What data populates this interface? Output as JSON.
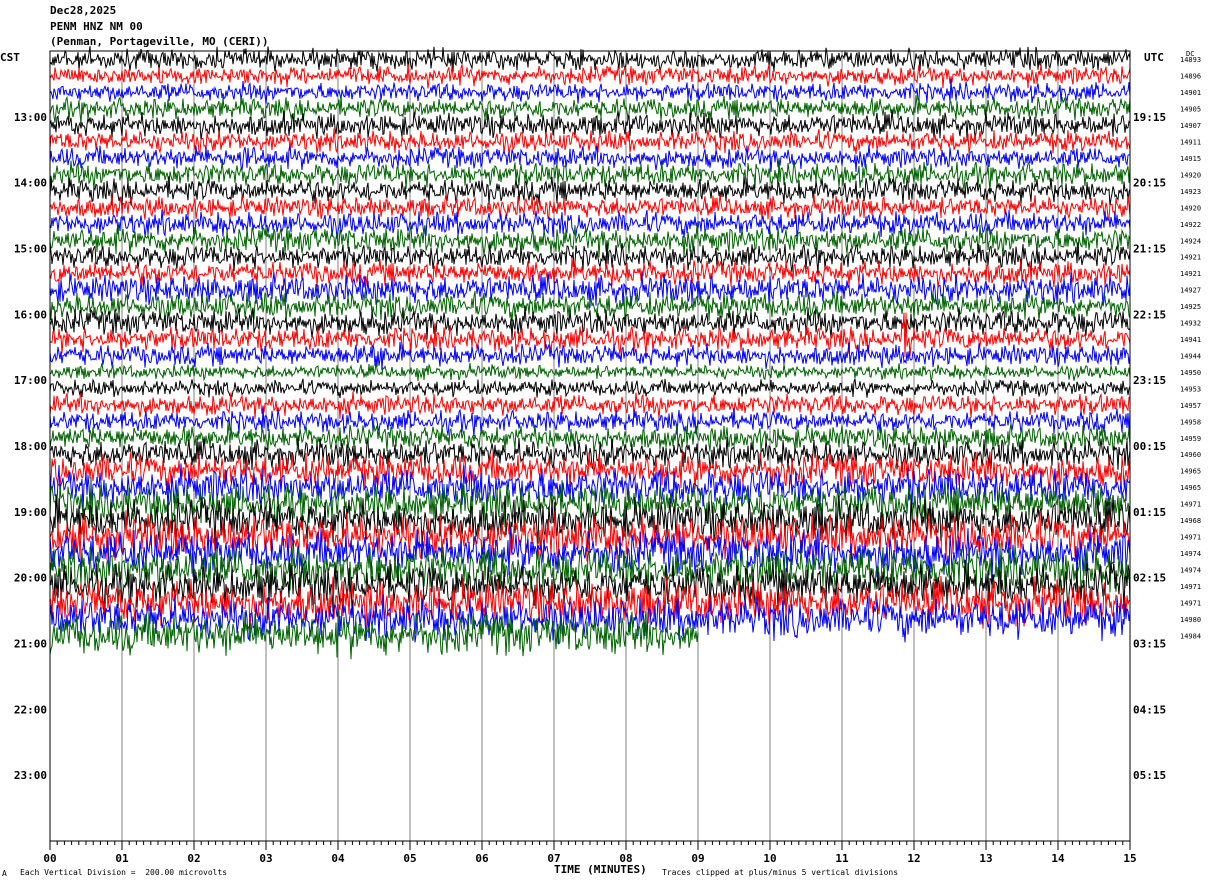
{
  "header": {
    "date": "Dec28,2025",
    "station": "PENM HNZ NM 00",
    "location": "(Penman, Portageville, MO (CERI))"
  },
  "left_timezone": "CST",
  "right_timezone": "UTC",
  "dc_label": "DC",
  "footer": {
    "left_mark": "A",
    "scale_note": "Each Vertical Division =  200.00 microvolts",
    "clip_note": "Traces clipped at plus/minus 5 vertical divisions"
  },
  "colors": {
    "trace_cycle": [
      "#000000",
      "#ff0000",
      "#0000ff",
      "#006400"
    ],
    "grid": "#808080",
    "frame": "#000000"
  },
  "chart_data": {
    "type": "line",
    "title": "PENM HNZ NM 00",
    "xlabel": "TIME (MINUTES)",
    "ylabel": "",
    "xlim": [
      0,
      15
    ],
    "x_ticks": [
      "00",
      "01",
      "02",
      "03",
      "04",
      "05",
      "06",
      "07",
      "08",
      "09",
      "10",
      "11",
      "12",
      "13",
      "14",
      "15"
    ],
    "left_hour_labels": [
      "13:00",
      "14:00",
      "15:00",
      "16:00",
      "17:00",
      "18:00",
      "19:00",
      "20:00",
      "21:00",
      "22:00",
      "23:00"
    ],
    "right_hour_labels": [
      "19:15",
      "20:15",
      "21:15",
      "22:15",
      "23:15",
      "00:15",
      "01:15",
      "02:15",
      "03:15",
      "04:15",
      "05:15"
    ],
    "rows_per_hour": 4,
    "total_rows": 48,
    "trace_count": 36,
    "last_trace_end_minute": 9,
    "dc_offsets": [
      14893,
      14896,
      14901,
      14905,
      14907,
      14911,
      14915,
      14920,
      14923,
      14920,
      14922,
      14924,
      14921,
      14921,
      14927,
      14925,
      14932,
      14941,
      14944,
      14950,
      14953,
      14957,
      14958,
      14959,
      14960,
      14965,
      14965,
      14971,
      14968,
      14971,
      14974,
      14974,
      14971,
      14971,
      14980,
      14984
    ],
    "trace_amplitude_rel": [
      0.45,
      0.4,
      0.4,
      0.45,
      0.5,
      0.45,
      0.45,
      0.5,
      0.5,
      0.45,
      0.5,
      0.55,
      0.5,
      0.5,
      0.6,
      0.55,
      0.55,
      0.5,
      0.45,
      0.3,
      0.35,
      0.45,
      0.45,
      0.5,
      0.6,
      0.7,
      0.8,
      0.8,
      0.85,
      0.9,
      0.9,
      0.95,
      0.9,
      0.9,
      0.85,
      0.9
    ],
    "events": [
      {
        "row": 17,
        "minute": 11.85,
        "scale": 3.0
      },
      {
        "row": 18,
        "minute": 4.5,
        "scale": 2.5
      },
      {
        "row": 6,
        "minute": 2.7,
        "scale": 2.2
      }
    ]
  }
}
